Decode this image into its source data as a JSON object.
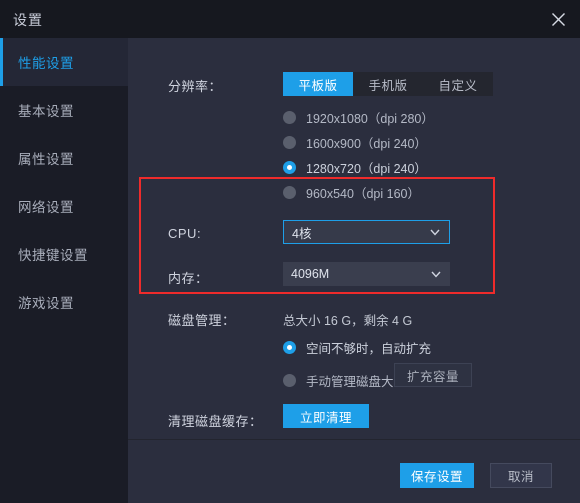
{
  "window": {
    "title": "设置",
    "close_icon": "close-icon"
  },
  "colors": {
    "accent": "#1e9fe8",
    "annotation": "#ef2b2b",
    "sidebar_bg": "#1a1c26",
    "main_bg": "#2b2e3e",
    "titlebar_bg": "#16181f"
  },
  "sidebar": {
    "items": [
      {
        "label": "性能设置",
        "active": true
      },
      {
        "label": "基本设置",
        "active": false
      },
      {
        "label": "属性设置",
        "active": false
      },
      {
        "label": "网络设置",
        "active": false
      },
      {
        "label": "快捷键设置",
        "active": false
      },
      {
        "label": "游戏设置",
        "active": false
      }
    ]
  },
  "main": {
    "resolution": {
      "label": "分辨率：",
      "tabs": [
        {
          "label": "平板版",
          "active": true
        },
        {
          "label": "手机版",
          "active": false
        },
        {
          "label": "自定义",
          "active": false
        }
      ],
      "options": [
        {
          "label": "1920x1080（dpi 280）",
          "selected": false
        },
        {
          "label": "1600x900（dpi 240）",
          "selected": false
        },
        {
          "label": "1280x720（dpi 240）",
          "selected": true
        },
        {
          "label": "960x540（dpi 160）",
          "selected": false
        }
      ]
    },
    "cpu": {
      "label": "CPU:",
      "value": "4核",
      "focused": true
    },
    "memory": {
      "label": "内存：",
      "value": "4096M",
      "focused": false
    },
    "disk": {
      "label": "磁盘管理：",
      "summary": "总大小 16 G，剩余 4 G",
      "options": [
        {
          "label": "空间不够时，自动扩充",
          "selected": true
        },
        {
          "label": "手动管理磁盘大小",
          "selected": false
        }
      ],
      "expand_button": "扩充容量"
    },
    "cache": {
      "label": "清理磁盘缓存：",
      "button": "立即清理"
    }
  },
  "footer": {
    "save_label": "保存设置",
    "cancel_label": "取消"
  }
}
